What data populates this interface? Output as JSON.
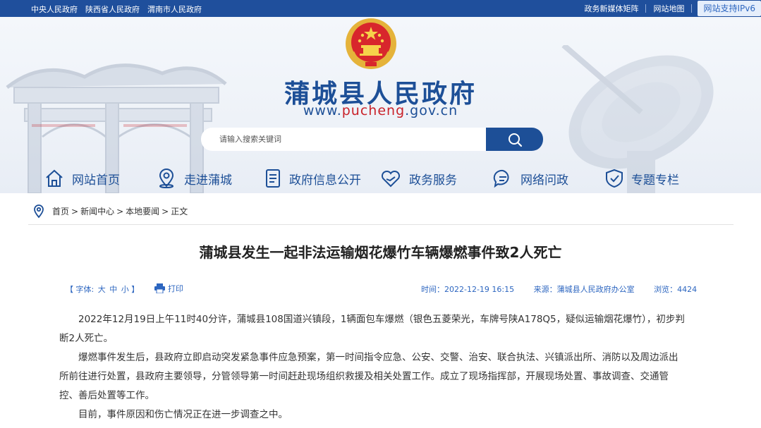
{
  "topbar": {
    "left_links": [
      "中央人民政府",
      "陕西省人民政府",
      "渭南市人民政府"
    ],
    "right_links": [
      "政务新媒体矩阵",
      "网站地图"
    ],
    "ipv6": "网站支持IPv6"
  },
  "header": {
    "title": "蒲城县人民政府",
    "url_prefix": "www.",
    "url_highlight": "pucheng",
    "url_suffix": ".gov.cn"
  },
  "search": {
    "placeholder": "请输入搜索关键词",
    "button_icon": "search-icon"
  },
  "nav": [
    {
      "label": "网站首页",
      "icon": "home-icon"
    },
    {
      "label": "走进蒲城",
      "icon": "location-icon"
    },
    {
      "label": "政府信息公开",
      "icon": "document-icon"
    },
    {
      "label": "政务服务",
      "icon": "heart-hand-icon"
    },
    {
      "label": "网络问政",
      "icon": "chat-icon"
    },
    {
      "label": "专题专栏",
      "icon": "shield-icon"
    }
  ],
  "breadcrumb": [
    "首页",
    "新闻中心",
    "本地要闻",
    "正文"
  ],
  "article": {
    "title": "蒲城县发生一起非法运输烟花爆竹车辆爆燃事件致2人死亡",
    "font_label": "【 字体:",
    "font_sizes": [
      "大",
      "中",
      "小"
    ],
    "font_close": "】",
    "print_label": "打印",
    "time": "时间：2022-12-19 16:15",
    "source": "来源：蒲城县人民政府办公室",
    "views": "浏览：4424",
    "paragraphs": [
      "2022年12月19日上午11时40分许，蒲城县108国道兴镇段，1辆面包车爆燃（银色五菱荣光，车牌号陕A178Q5，疑似运输烟花爆竹），初步判断2人死亡。",
      "爆燃事件发生后，县政府立即启动突发紧急事件应急预案，第一时间指令应急、公安、交警、治安、联合执法、兴镇派出所、消防以及周边派出所前往进行处置，县政府主要领导，分管领导第一时间赶赴现场组织救援及相关处置工作。成立了现场指挥部，开展现场处置、事故调查、交通管控、善后处置等工作。",
      "目前，事件原因和伤亡情况正在进一步调查之中。"
    ]
  },
  "colors": {
    "primary": "#1d4f97",
    "topbar": "#1f4f9c",
    "accent_red": "#c9222a",
    "link_blue": "#2d66c0"
  }
}
